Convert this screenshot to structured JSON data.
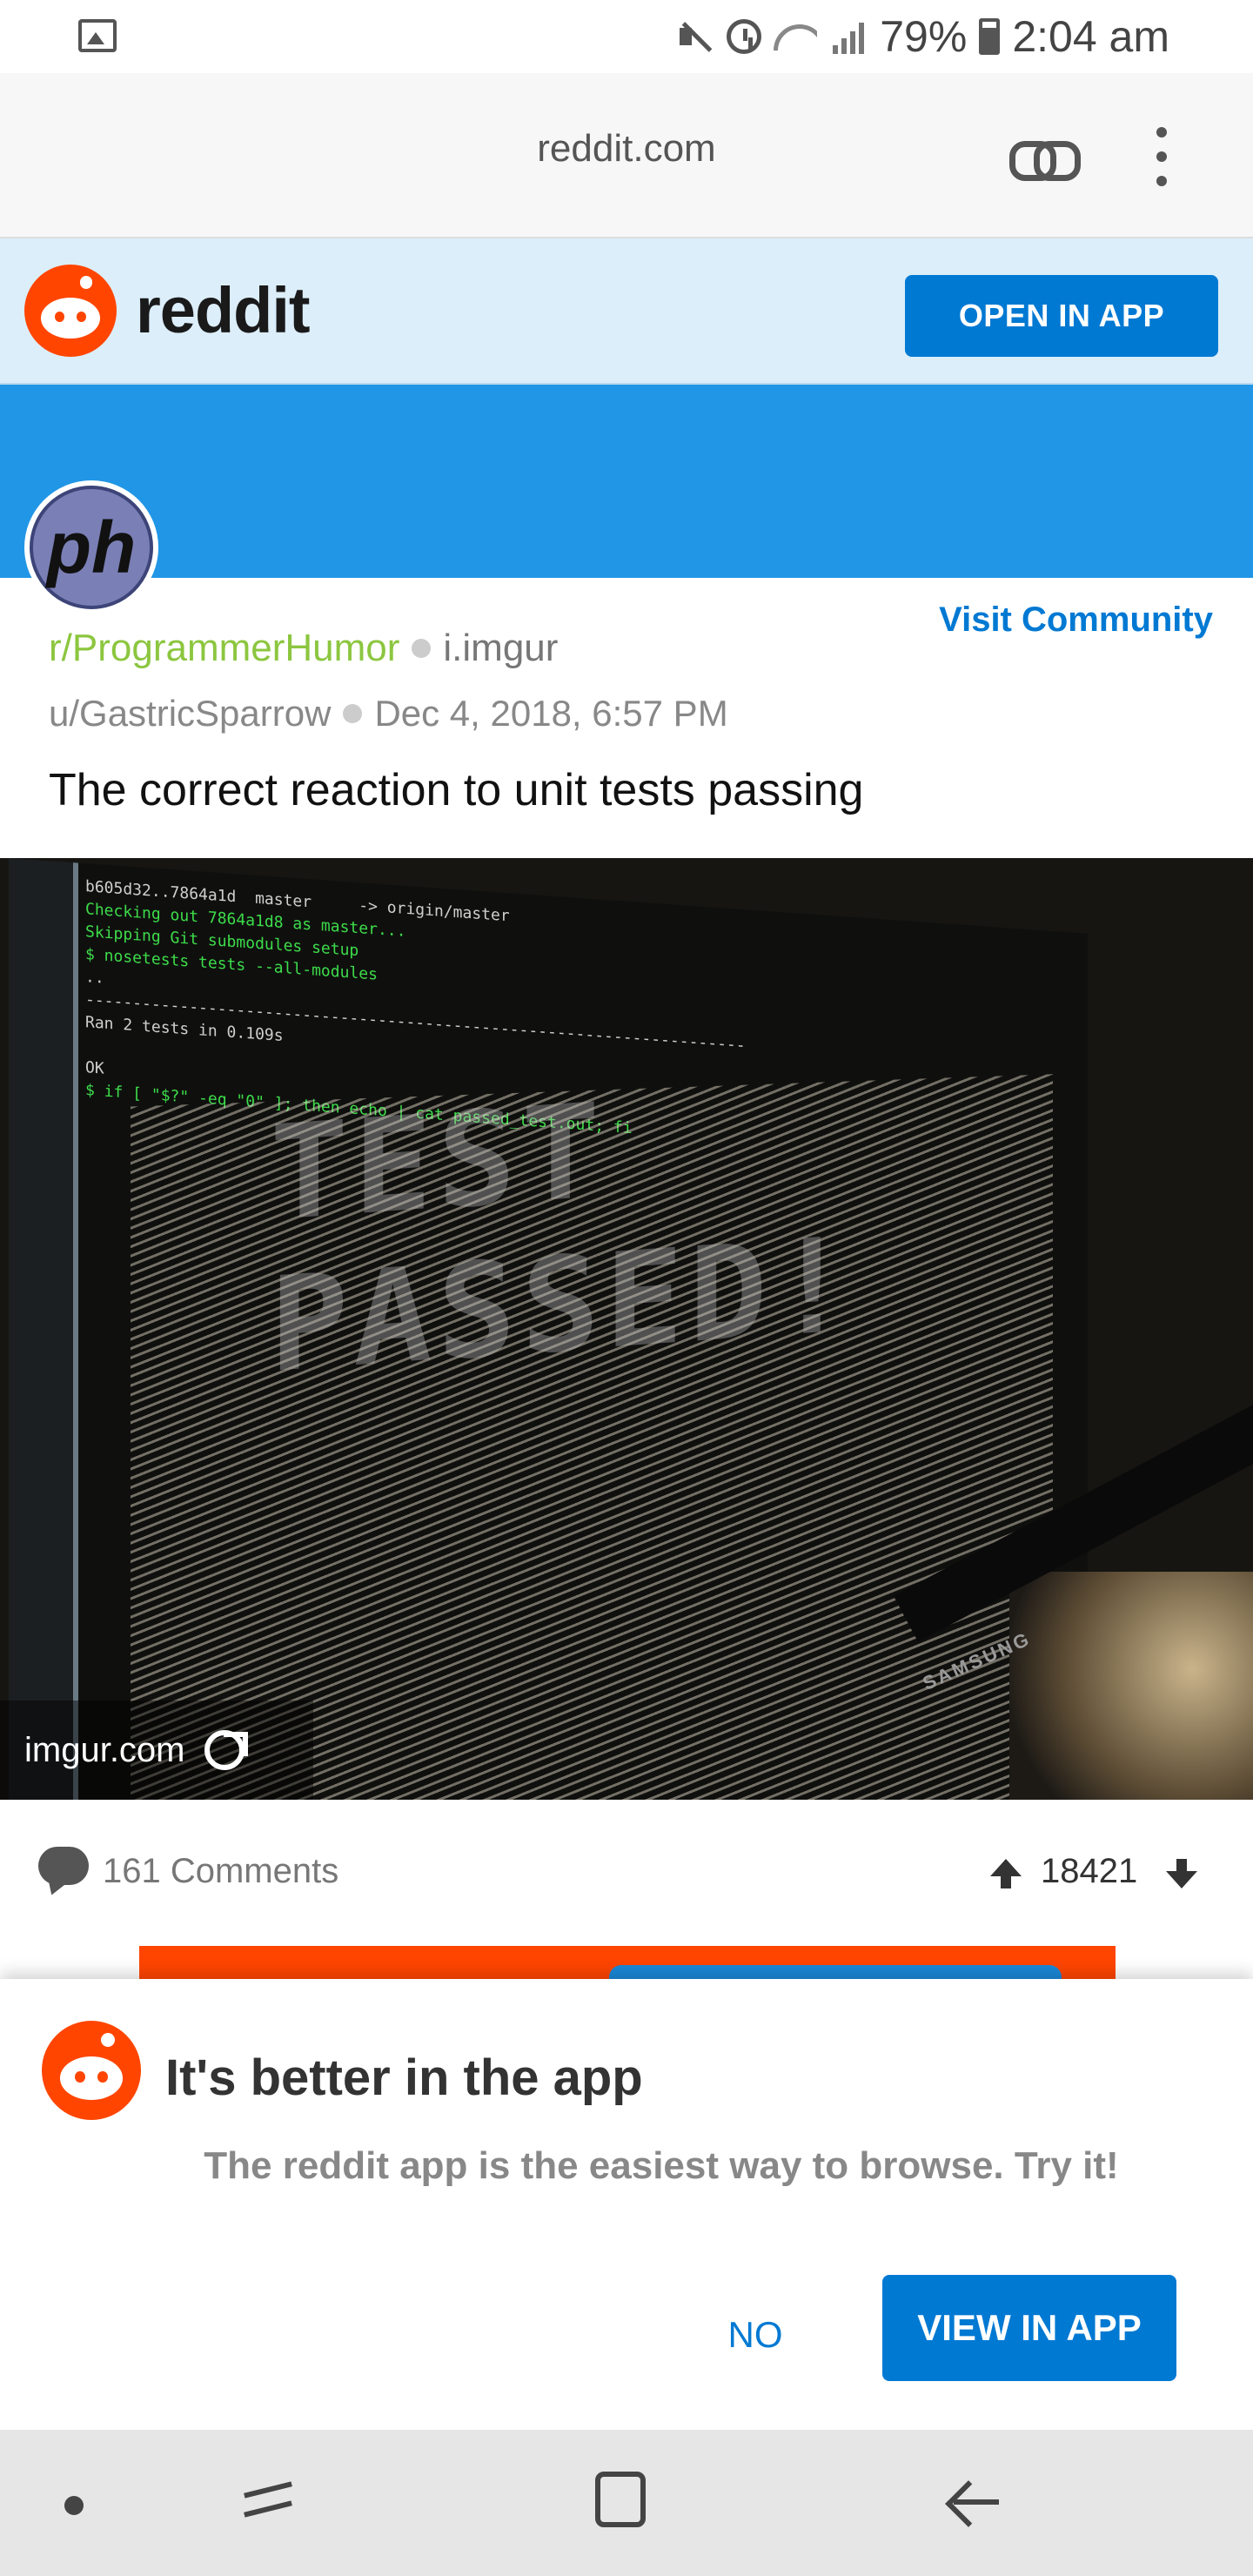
{
  "status_bar": {
    "battery": "79%",
    "time": "2:04 am"
  },
  "browser": {
    "url": "reddit.com"
  },
  "header": {
    "wordmark": "reddit",
    "open_in_app": "OPEN IN APP"
  },
  "community": {
    "avatar_text": "ph",
    "visit_label": "Visit Community"
  },
  "post": {
    "subreddit": "r/ProgrammerHumor",
    "domain": "i.imgur",
    "author": "u/GastricSparrow",
    "date": "Dec 4, 2018, 6:57 PM",
    "title": "The correct reaction to unit tests passing",
    "image_source": "imgur.com",
    "comments": "161 Comments",
    "score": "18421"
  },
  "image": {
    "terminal_lines": [
      "b605d32..7864a1d  master     -> origin/master",
      "Checking out 7864a1d8 as master...",
      "Skipping Git submodules setup",
      "$ nosetests tests --all-modules",
      "..",
      "----------------------------------------------------------------------",
      "Ran 2 tests in 0.109s",
      "",
      "OK",
      "$ if [ \"$?\" -eq \"0\" ]; then echo | cat passed_test.out; fi"
    ],
    "banner_text": "TEST PASSED!",
    "monitor_brand": "SAMSUNG"
  },
  "sheet": {
    "title": "It's better in the app",
    "subtitle": "The reddit app is the easiest way to browse. Try it!",
    "no": "NO",
    "view": "VIEW IN APP"
  },
  "colors": {
    "brand": "#ff4500",
    "accent": "#0079d3",
    "banner": "#2196e6",
    "subreddit": "#8cc63f"
  }
}
